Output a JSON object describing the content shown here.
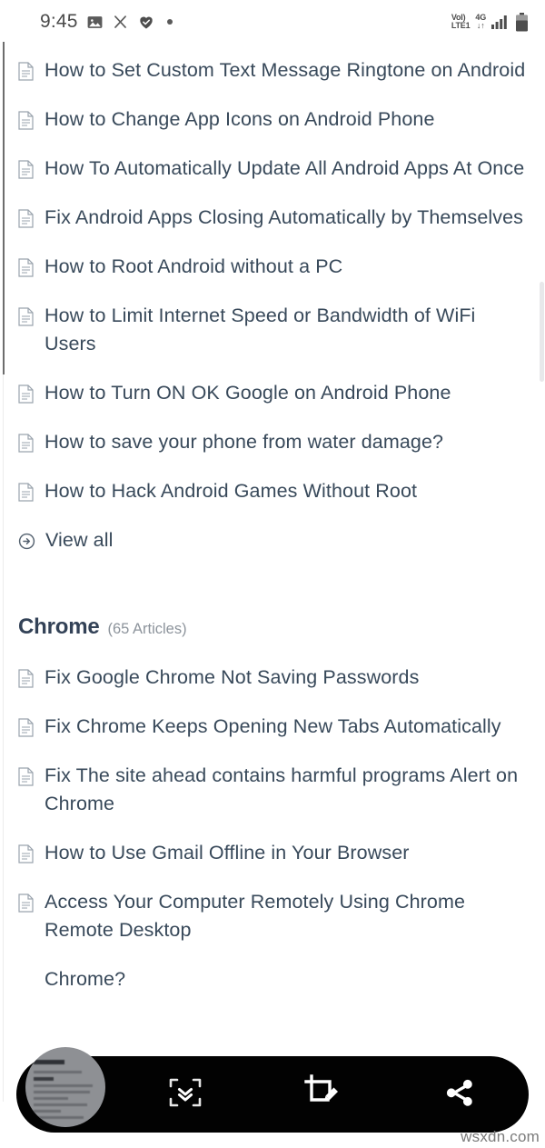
{
  "status_bar": {
    "time": "9:45",
    "left_icons": [
      "image-icon",
      "scissors-icon",
      "heart-check-icon",
      "dot-icon"
    ],
    "volte_top": "VoI)",
    "volte_bottom": "LTE1",
    "network_top": "4G",
    "network_bottom": "↓↑",
    "right_icons": [
      "signal-bars-icon",
      "battery-icon"
    ]
  },
  "android_section": {
    "items": [
      {
        "label": "How to Set Custom Text Message Ringtone on Android",
        "icon": "document-icon"
      },
      {
        "label": "How to Change App Icons on Android Phone",
        "icon": "document-icon"
      },
      {
        "label": "How To Automatically Update All Android Apps At Once",
        "icon": "document-icon"
      },
      {
        "label": "Fix Android Apps Closing Automatically by Themselves",
        "icon": "document-icon"
      },
      {
        "label": "How to Root Android without a PC",
        "icon": "document-icon"
      },
      {
        "label": "How to Limit Internet Speed or Bandwidth of WiFi Users",
        "icon": "document-icon"
      },
      {
        "label": "How to Turn ON OK Google on Android Phone",
        "icon": "document-icon"
      },
      {
        "label": "How to save your phone from water damage?",
        "icon": "document-icon"
      },
      {
        "label": "How to Hack Android Games Without Root",
        "icon": "document-icon"
      }
    ],
    "view_all": {
      "label": "View all",
      "icon": "arrow-circle-right-icon"
    }
  },
  "chrome_section": {
    "title": "Chrome",
    "count": "(65 Articles)",
    "items": [
      {
        "label": "Fix Google Chrome Not Saving Passwords",
        "icon": "document-icon"
      },
      {
        "label": "Fix Chrome Keeps Opening New Tabs Automatically",
        "icon": "document-icon"
      },
      {
        "label": "Fix The site ahead contains harmful programs Alert on Chrome",
        "icon": "document-icon"
      },
      {
        "label": "How to Use Gmail Offline in Your Browser",
        "icon": "document-icon"
      },
      {
        "label": "Access Your Computer Remotely Using Chrome Remote Desktop",
        "icon": "document-icon"
      }
    ],
    "partial_item_below_toolbar": "Chrome?"
  },
  "screenshot_toolbar": {
    "thumbnail_label": "screenshot-preview-thumbnail",
    "buttons": [
      {
        "name": "scroll-capture-icon"
      },
      {
        "name": "crop-edit-icon"
      },
      {
        "name": "share-icon"
      }
    ]
  },
  "watermark": "wsxdn.com",
  "colors": {
    "text": "#38495a",
    "heading": "#334257",
    "muted": "#8d949c",
    "toolbar_bg": "#020202",
    "background": "#ffffff"
  }
}
